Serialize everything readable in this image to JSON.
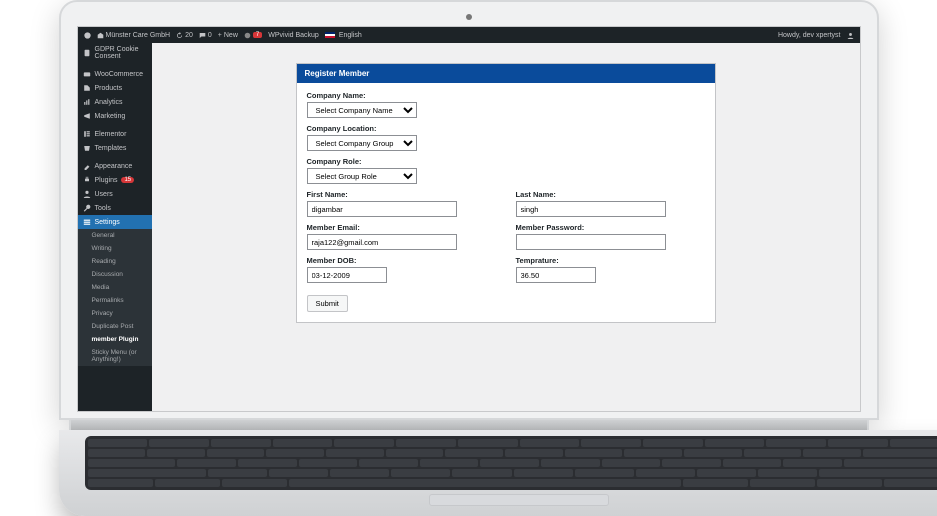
{
  "adminbar": {
    "site": "Münster Care GmbH",
    "updates": "20",
    "comments": "0",
    "new": "New",
    "plugin_badge": "7",
    "wpvivid": "WPvivid Backup",
    "lang": "English",
    "greeting": "Howdy, dev xpertyst"
  },
  "sidebar": {
    "gdpr": "GDPR Cookie Consent",
    "woo": "WooCommerce",
    "products": "Products",
    "analytics": "Analytics",
    "marketing": "Marketing",
    "elementor": "Elementor",
    "templates": "Templates",
    "appearance": "Appearance",
    "plugins": "Plugins",
    "plugins_count": "15",
    "users": "Users",
    "tools": "Tools",
    "settings": "Settings",
    "submenu": {
      "general": "General",
      "writing": "Writing",
      "reading": "Reading",
      "discussion": "Discussion",
      "media": "Media",
      "permalinks": "Permalinks",
      "privacy": "Privacy",
      "duplicate": "Duplicate Post",
      "member": "member Plugin",
      "sticky": "Sticky Menu (or Anything!)"
    }
  },
  "form": {
    "header": "Register Member",
    "company_name_label": "Company Name:",
    "company_name_option": "Select Company Name",
    "company_location_label": "Company Location:",
    "company_location_option": "Select Company Group",
    "company_role_label": "Company Role:",
    "company_role_option": "Select Group Role",
    "first_name_label": "First Name:",
    "first_name_value": "digambar",
    "last_name_label": "Last Name:",
    "last_name_value": "singh",
    "email_label": "Member Email:",
    "email_value": "raja122@gmail.com",
    "password_label": "Member Password:",
    "password_value": "",
    "dob_label": "Member DOB:",
    "dob_value": "03-12-2009",
    "temp_label": "Temprature:",
    "temp_value": "36.50",
    "submit": "Submit"
  }
}
